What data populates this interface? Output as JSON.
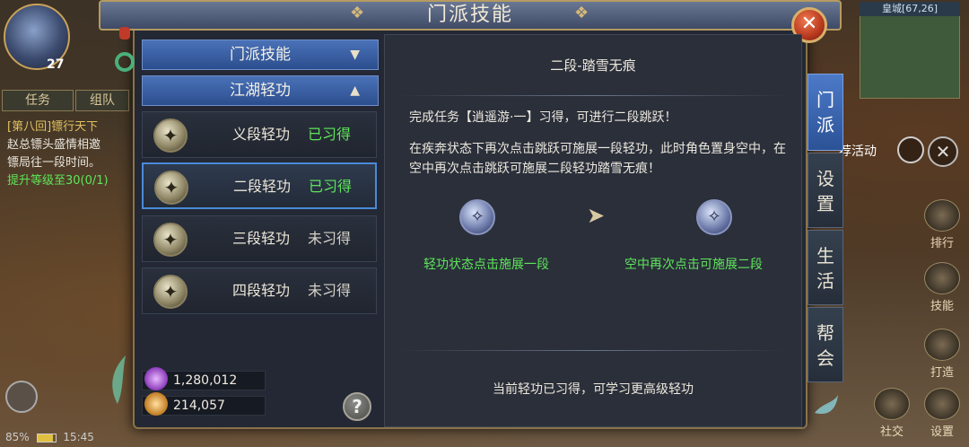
{
  "hud": {
    "level": "27",
    "tab_task": "任务",
    "tab_team": "组队",
    "quest_title": "[第八回]镖行天下",
    "quest_line1": "赵总镖头盛情相邀",
    "quest_line2": "镖局往一段时间。",
    "quest_progress": "提升等级至30(0/1)",
    "battery": "85%",
    "time": "15:45",
    "minimap_title": "皇城[67,26]",
    "event_label": "荐活动",
    "right_buttons": [
      "排行",
      "技能",
      "打造",
      "社交",
      "设置"
    ]
  },
  "dialog": {
    "title": "门派技能",
    "close_symbol": "✕",
    "categories": [
      {
        "label": "门派技能",
        "chevron": "▼"
      },
      {
        "label": "江湖轻功",
        "chevron": "▲"
      }
    ],
    "skills": [
      {
        "name": "义段轻功",
        "status": "已习得",
        "learned": true
      },
      {
        "name": "二段轻功",
        "status": "已习得",
        "learned": true
      },
      {
        "name": "三段轻功",
        "status": "未习得",
        "learned": false
      },
      {
        "name": "四段轻功",
        "status": "未习得",
        "learned": false
      }
    ],
    "currency": [
      {
        "icon": "gem-icon",
        "value": "1,280,012",
        "color": "#b86ad8"
      },
      {
        "icon": "gold-ingot-icon",
        "value": "214,057",
        "color": "#e0a040"
      }
    ],
    "help_symbol": "?",
    "detail": {
      "title": "二段-踏雪无痕",
      "para1": "完成任务【逍遥游·一】习得，可进行二段跳跃！",
      "para2": "在疾奔状态下再次点击跳跃可施展一段轻功，此时角色置身空中，在空中再次点击跳跃可施展二段轻功踏雪无痕！",
      "demo1_label": "轻功状态点击施展一段",
      "demo2_label": "空中再次点击可施展二段",
      "footer": "当前轻功已习得，可学习更高级轻功"
    },
    "side_tabs": [
      {
        "label": "门派",
        "active": true
      },
      {
        "label": "设置",
        "active": false
      },
      {
        "label": "生活",
        "active": false
      },
      {
        "label": "帮会",
        "active": false
      }
    ]
  },
  "colors": {
    "learned": "#5ee65a",
    "accent_blue": "#4a72b8",
    "frame_gold": "#b59a60",
    "close_red": "#b8381e"
  }
}
